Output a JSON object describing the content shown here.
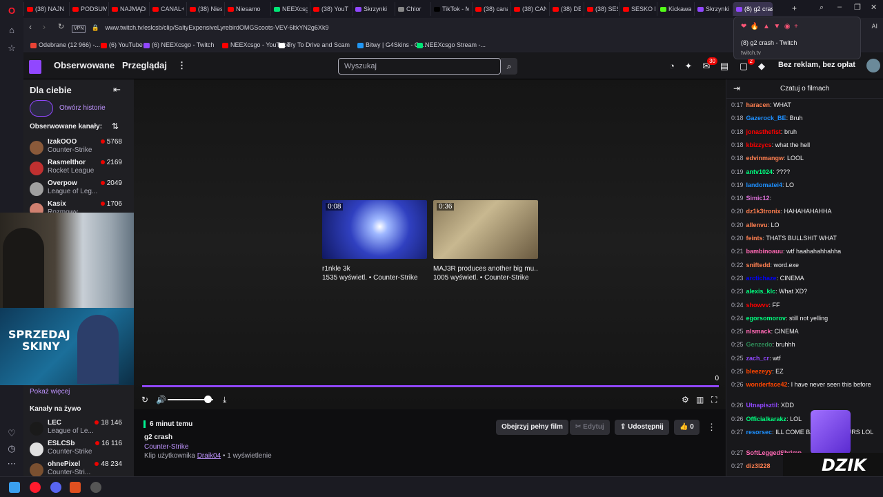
{
  "browser": {
    "tabs": [
      {
        "label": "(38) NAJN",
        "color": "#ff0000"
      },
      {
        "label": "PODSUM",
        "color": "#ff0000"
      },
      {
        "label": "NAJMĄDR",
        "color": "#ff0000"
      },
      {
        "label": "CANAL+",
        "color": "#ff0000"
      },
      {
        "label": "(38) Nies",
        "color": "#ff0000"
      },
      {
        "label": "Niesamo",
        "color": "#ff0000"
      },
      {
        "label": "NEEXcsg",
        "color": "#00e676"
      },
      {
        "label": "(38) YouT",
        "color": "#ff0000"
      },
      {
        "label": "Skrzynki",
        "color": "#9147ff"
      },
      {
        "label": "Chlor",
        "color": "#888888"
      },
      {
        "label": "TikTok - M",
        "color": "#000000"
      },
      {
        "label": "(38) cana",
        "color": "#ff0000"
      },
      {
        "label": "(38) CAN",
        "color": "#ff0000"
      },
      {
        "label": "(38) DEC",
        "color": "#ff0000"
      },
      {
        "label": "(38) SESK",
        "color": "#ff0000"
      },
      {
        "label": "SESKO R",
        "color": "#ff0000"
      },
      {
        "label": "Kickaway",
        "color": "#53fc18"
      },
      {
        "label": "Skrzynki",
        "color": "#9147ff"
      },
      {
        "label": "(8) g2 crash",
        "color": "#9147ff"
      }
    ],
    "url": "www.twitch.tv/eslcsb/clip/SaltyExpensiveLyrebirdOMGScoots-VEV-6ltkYN2g6Xk9",
    "vpn_label": "VPN",
    "ai_label": "AI",
    "bookmarks": [
      {
        "label": "Odebrane (12 966) -...",
        "color": "#ea4335"
      },
      {
        "label": "(6) YouTube",
        "color": "#ff0000"
      },
      {
        "label": "(6) NEEXcsgo - Twitch",
        "color": "#9147ff"
      },
      {
        "label": "NEEXcsgo - YouTube",
        "color": "#ff0000"
      },
      {
        "label": "Try To Drive and Scam",
        "color": "#ffffff"
      },
      {
        "label": "Bitwy | G4Skins - Ot...",
        "color": "#2196f3"
      },
      {
        "label": "NEEXcsgo Stream -...",
        "color": "#00e676"
      }
    ],
    "hovercard": {
      "title": "(8) g2 crash - Twitch",
      "domain": "twitch.tv"
    }
  },
  "twitch": {
    "nav": {
      "following": "Obserwowane",
      "browse": "Przeglądaj",
      "more": "⋮",
      "search_placeholder": "Wyszukaj",
      "badges": {
        "inbox": "30",
        "notifications": "2"
      },
      "ad_free": "Bez reklam, bez opłat"
    },
    "sidebar": {
      "title": "Dla ciebie",
      "open_history": "Otwórz historie",
      "followed_heading": "Obserwowane kanały:",
      "followed": [
        {
          "name": "IzakOOO",
          "game": "Counter-Strike",
          "viewers": "5768",
          "color": "#8a5a3a"
        },
        {
          "name": "Rasmelthor",
          "game": "Rocket League",
          "viewers": "2169",
          "color": "#c03030"
        },
        {
          "name": "Overpow",
          "game": "League of Leg...",
          "viewers": "2049",
          "color": "#a0a0a0"
        },
        {
          "name": "Kasix",
          "game": "Rozmowy",
          "viewers": "1706",
          "color": "#d08070"
        }
      ],
      "show_more": "Pokaż więcej",
      "live_heading": "Kanały na żywo",
      "live": [
        {
          "name": "LEC",
          "game": "League of Le...",
          "viewers": "18 146",
          "color": "#1a1a1a"
        },
        {
          "name": "ESLCSb",
          "game": "Counter-Strike",
          "viewers": "16 116",
          "color": "#e0e0e0"
        },
        {
          "name": "ohnePixel",
          "game": "Counter-Stri...",
          "viewers": "48 234",
          "color": "#7a5030"
        }
      ]
    },
    "ad": {
      "title_line1": "SPRZEDAJ",
      "title_line2": "SKINY"
    },
    "player": {
      "recommended": [
        {
          "duration": "0:08",
          "title": "r1nkle 3k",
          "meta": "1535 wyświetl. • Counter-Strike"
        },
        {
          "duration": "0:36",
          "title": "MAJ3R produces another big mu...",
          "meta": "1005 wyświetl. • Counter-Strike"
        }
      ],
      "time": "0",
      "volume": 0.9
    },
    "clip": {
      "age": "6 minut temu",
      "title": "g2 crash",
      "category": "Counter-Strike",
      "clipped_by_prefix": "Klip użytkownika",
      "clipper": "Draik04",
      "views": "1 wyświetlenie",
      "watch_full": "Obejrzyj pełny film",
      "edit": "Edytuj",
      "share": "Udostępnij",
      "likes": "0"
    },
    "chat": {
      "header": "Czatuj o filmach",
      "messages": [
        {
          "t": "0:17",
          "user": "haracen",
          "color": "#ff7f50",
          "text": ": WHAT"
        },
        {
          "t": "0:18",
          "user": "Gazerock_BE",
          "color": "#1e90ff",
          "text": ": Bruh"
        },
        {
          "t": "0:18",
          "user": "jonasthefist",
          "color": "#ff0000",
          "text": ": bruh"
        },
        {
          "t": "0:18",
          "user": "kbizzycs",
          "color": "#ff0000",
          "text": ": what the hell"
        },
        {
          "t": "0:18",
          "user": "edvinmangw",
          "color": "#ff7f50",
          "text": ": LOOL"
        },
        {
          "t": "0:19",
          "user": "antv1024",
          "color": "#00ff7f",
          "text": ": ????"
        },
        {
          "t": "0:19",
          "user": "landomatei4",
          "color": "#1e90ff",
          "text": ": LO"
        },
        {
          "t": "0:19",
          "user": "Simic12",
          "color": "#da70d6",
          "text": ":"
        },
        {
          "t": "0:20",
          "user": "dz1k3tronix",
          "color": "#ff7f50",
          "text": ": HAHAHAHAHHA"
        },
        {
          "t": "0:20",
          "user": "allenvu",
          "color": "#ff7f50",
          "text": ": LO"
        },
        {
          "t": "0:20",
          "user": "feints",
          "color": "#ff7f50",
          "text": ": THATS BULLSHIT WHAT"
        },
        {
          "t": "0:21",
          "user": "bambinoauu",
          "color": "#ff69b4",
          "text": ": wtf haahahahhahha"
        },
        {
          "t": "0:22",
          "user": "sniftedd",
          "color": "#ff7f50",
          "text": ": word.exe"
        },
        {
          "t": "0:23",
          "user": "arctichaze",
          "color": "#0000ff",
          "text": ": CINEMA"
        },
        {
          "t": "0:23",
          "user": "alexis_klc",
          "color": "#00ff7f",
          "text": ": What XD?"
        },
        {
          "t": "0:24",
          "user": "showvv",
          "color": "#ff0000",
          "text": ": FF"
        },
        {
          "t": "0:24",
          "user": "egorsomorov",
          "color": "#00ff7f",
          "text": ": still not yelling"
        },
        {
          "t": "0:25",
          "user": "nlsmack",
          "color": "#ff69b4",
          "text": ": CINEMA"
        },
        {
          "t": "0:25",
          "user": "Genzedo",
          "color": "#2e8b57",
          "text": ": bruhhh"
        },
        {
          "t": "0:25",
          "user": "zach_cr",
          "color": "#9147ff",
          "text": ": wtf"
        },
        {
          "t": "0:25",
          "user": "bleezeyy",
          "color": "#ff4500",
          "text": ": EZ"
        },
        {
          "t": "0:26",
          "user": "wonderface42",
          "color": "#ff4500",
          "text": ": I have never seen this before"
        },
        {
          "t": "0:26",
          "user": "Utnapisztil",
          "color": "#9147ff",
          "text": ": XDD"
        },
        {
          "t": "0:26",
          "user": "Officialkarakz",
          "color": "#00ff7f",
          "text": ": LOL"
        },
        {
          "t": "0:27",
          "user": "resorsec",
          "color": "#1e90ff",
          "text": ": ILL COME BACK IN 6 HOURS LOL"
        },
        {
          "t": "0:27",
          "user": "SoftLeggedShrimp",
          "color": "#ff69b4",
          "text": ""
        },
        {
          "t": "0:27",
          "user": "diz3l228",
          "color": "#ff7f50",
          "text": ""
        }
      ]
    }
  },
  "overlay": {
    "brand": "DZIK"
  }
}
